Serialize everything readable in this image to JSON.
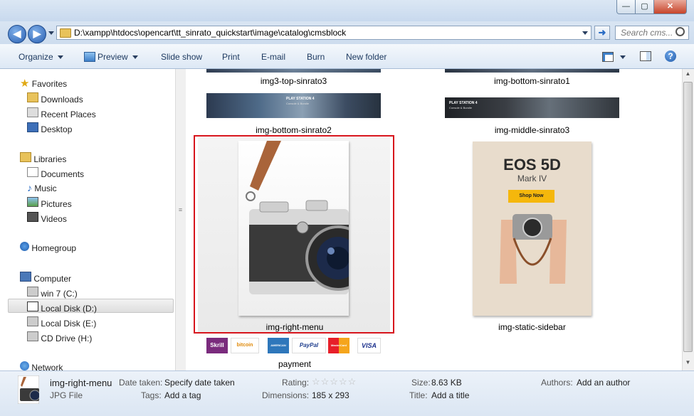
{
  "window": {
    "controls": {
      "minimize": "—",
      "maximize": "▢",
      "close": "✕"
    }
  },
  "address": {
    "path": "D:\\xampp\\htdocs\\opencart\\tt_sinrato_quickstart\\image\\catalog\\cmsblock",
    "search_placeholder": "Search cms..."
  },
  "toolbar": {
    "organize": "Organize",
    "preview": "Preview",
    "slideshow": "Slide show",
    "print": "Print",
    "email": "E-mail",
    "burn": "Burn",
    "new_folder": "New folder"
  },
  "sidebar": {
    "favorites": "Favorites",
    "downloads": "Downloads",
    "recent": "Recent Places",
    "desktop": "Desktop",
    "libraries": "Libraries",
    "documents": "Documents",
    "music": "Music",
    "pictures": "Pictures",
    "videos": "Videos",
    "homegroup": "Homegroup",
    "computer": "Computer",
    "win7": "win 7 (C:)",
    "local_d": "Local Disk (D:)",
    "local_e": "Local Disk (E:)",
    "cd": "CD Drive (H:)",
    "network": "Network"
  },
  "files": {
    "f1": "img3-top-sinrato3",
    "f2": "img-bottom-sinrato1",
    "f3": "img-bottom-sinrato2",
    "f4": "img-middle-sinrato3",
    "f5": "img-right-menu",
    "f6": "img-static-sidebar",
    "f7": "payment"
  },
  "thumbs": {
    "banner_title": "PLAY STATION 4",
    "banner_sub": "Console & Bundle",
    "eos_title": "EOS 5D",
    "eos_sub": "Mark IV",
    "eos_btn": "Shop Now",
    "pay_skrill": "Skrill",
    "pay_bitcoin": "bitcoin",
    "pay_amex": "AMERICAN EXPRESS",
    "pay_paypal": "PayPal",
    "pay_mc": "MasterCard",
    "pay_visa": "VISA"
  },
  "details": {
    "name": "img-right-menu",
    "type": "JPG File",
    "date_label": "Date taken:",
    "date_val": "Specify date taken",
    "tags_label": "Tags:",
    "tags_val": "Add a tag",
    "rating_label": "Rating:",
    "stars": "☆☆☆☆☆",
    "dims_label": "Dimensions:",
    "dims_val": "185 x 293",
    "size_label": "Size:",
    "size_val": "8.63 KB",
    "title_label": "Title:",
    "title_val": "Add a title",
    "authors_label": "Authors:",
    "authors_val": "Add an author"
  },
  "colors": {
    "selection": "#d7141c",
    "accent": "#2a5fb1"
  }
}
